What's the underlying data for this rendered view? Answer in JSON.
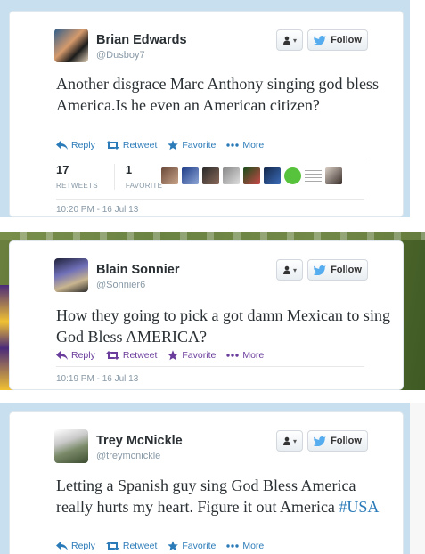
{
  "tweets": [
    {
      "name": "Brian Edwards",
      "handle": "@Dusboy7",
      "text": "Another disgrace Marc Anthony singing god bless America.Is he even an American citizen?",
      "actions": {
        "reply": "Reply",
        "retweet": "Retweet",
        "favorite": "Favorite",
        "more": "More"
      },
      "follow_label": "Follow",
      "stats": {
        "retweets": "17",
        "retweets_label": "RETWEETS",
        "favorites": "1",
        "favorites_label": "FAVORITE"
      },
      "timestamp": "10:20 PM - 16 Jul 13",
      "accent": "#2b7bb9"
    },
    {
      "name": "Blain Sonnier",
      "handle": "@Sonnier6",
      "text": "How they going to pick a got damn Mexican to sing God Bless AMERICA?",
      "actions": {
        "reply": "Reply",
        "retweet": "Retweet",
        "favorite": "Favorite",
        "more": "More"
      },
      "follow_label": "Follow",
      "timestamp": "10:19 PM - 16 Jul 13",
      "accent": "#6a3c9b"
    },
    {
      "name": "Trey McNickle",
      "handle": "@treymcnickle",
      "text_before": "Letting a Spanish guy sing God Bless America really hurts my heart. Figure it out America ",
      "hashtag": "#USA",
      "actions": {
        "reply": "Reply",
        "retweet": "Retweet",
        "favorite": "Favorite",
        "more": "More"
      },
      "follow_label": "Follow",
      "accent": "#2b7bb9"
    }
  ],
  "icons": {
    "user": "user-icon",
    "bird": "twitter-bird-icon",
    "reply": "reply-arrow-icon",
    "retweet": "retweet-icon",
    "favorite": "star-icon",
    "more": "more-dots-icon"
  }
}
